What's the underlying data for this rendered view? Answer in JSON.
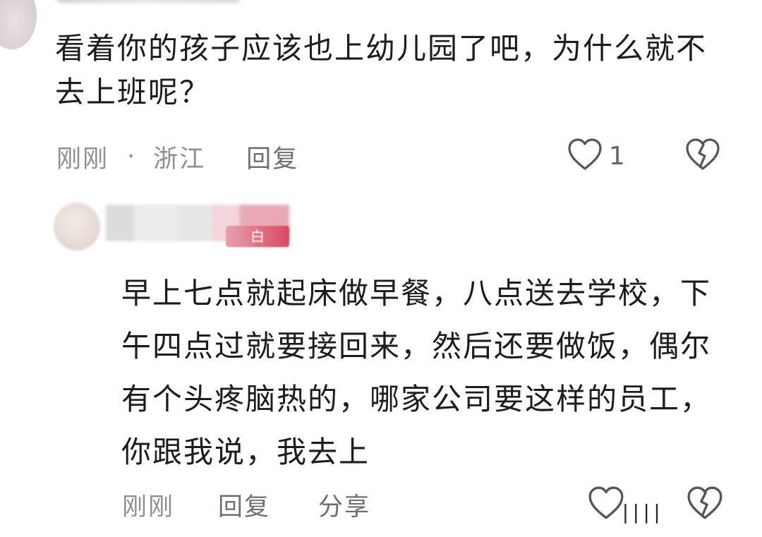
{
  "comments": [
    {
      "text": "看着你的孩子应该也上幼儿园了吧，为什么就不去上班呢？",
      "time": "刚刚",
      "separator": "·",
      "location": "浙江",
      "reply_label": "回复",
      "like_count": "1"
    },
    {
      "text": "早上七点就起床做早餐，八点送去学校，下午四点过就要接回来，然后还要做饭，偶尔有个头疼脑热的，哪家公司要这样的员工，你跟我说，我去上",
      "badge": "白",
      "time": "刚刚",
      "reply_label": "回复",
      "share_label": "分享"
    }
  ],
  "watermark": "||||",
  "icons": {
    "like": "heart-outline-icon",
    "dislike": "broken-heart-icon"
  },
  "colors": {
    "text": "#1c1c1c",
    "meta": "#8f8f8f",
    "badge": "#d9485f"
  }
}
